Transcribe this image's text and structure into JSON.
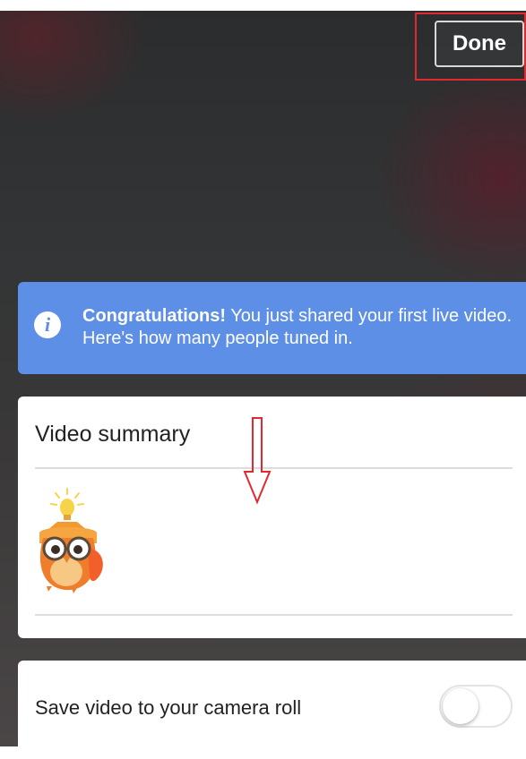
{
  "header": {
    "done_label": "Done"
  },
  "banner": {
    "icon": "info-icon",
    "icon_glyph": "i",
    "title": "Congratulations!",
    "message": " You just shared your first live video. Here's how many people tuned in."
  },
  "summary": {
    "title": "Video summary",
    "illustration": "owl-icon"
  },
  "save": {
    "label": "Save video to your camera roll",
    "toggle_on": false
  },
  "colors": {
    "banner": "#5d8fe7",
    "highlight": "#e02a2f"
  }
}
